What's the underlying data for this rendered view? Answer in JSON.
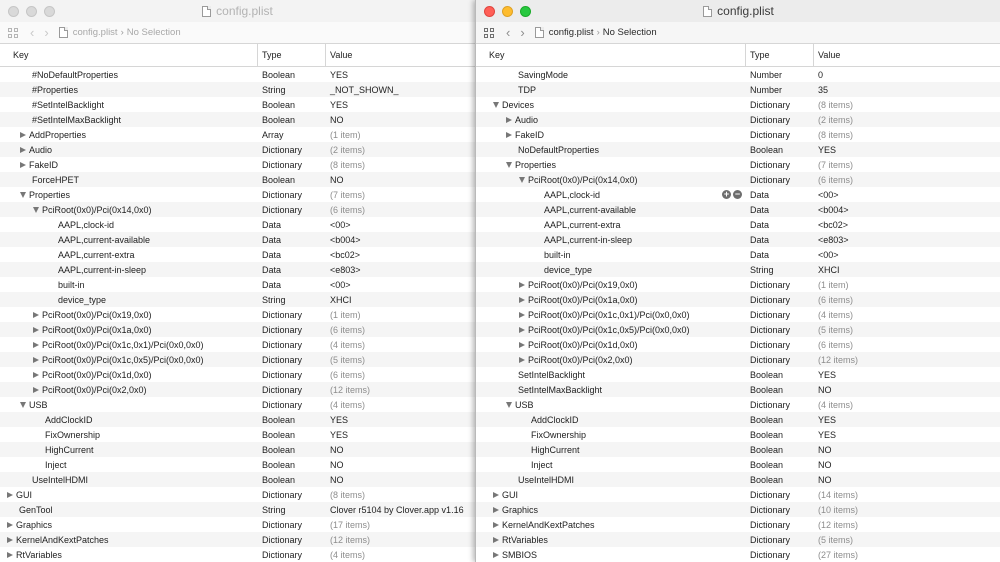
{
  "left": {
    "title": "config.plist",
    "crumb_file": "config.plist",
    "crumb_selection": "No Selection",
    "columns": {
      "key": "Key",
      "type": "Type",
      "value": "Value"
    },
    "rows": [
      {
        "key": "#NoDefaultProperties",
        "type": "Boolean",
        "value": "YES",
        "depth": 2,
        "disclosure": "none",
        "muted": false
      },
      {
        "key": "#Properties",
        "type": "String",
        "value": "_NOT_SHOWN_",
        "depth": 2,
        "disclosure": "none",
        "muted": false
      },
      {
        "key": "#SetIntelBacklight",
        "type": "Boolean",
        "value": "YES",
        "depth": 2,
        "disclosure": "none",
        "muted": false
      },
      {
        "key": "#SetIntelMaxBacklight",
        "type": "Boolean",
        "value": "NO",
        "depth": 2,
        "disclosure": "none",
        "muted": false
      },
      {
        "key": "AddProperties",
        "type": "Array",
        "value": "(1 item)",
        "depth": 2,
        "disclosure": "collapsed",
        "muted": true
      },
      {
        "key": "Audio",
        "type": "Dictionary",
        "value": "(2 items)",
        "depth": 2,
        "disclosure": "collapsed",
        "muted": true
      },
      {
        "key": "FakeID",
        "type": "Dictionary",
        "value": "(8 items)",
        "depth": 2,
        "disclosure": "collapsed",
        "muted": true
      },
      {
        "key": "ForceHPET",
        "type": "Boolean",
        "value": "NO",
        "depth": 2,
        "disclosure": "none",
        "muted": false
      },
      {
        "key": "Properties",
        "type": "Dictionary",
        "value": "(7 items)",
        "depth": 2,
        "disclosure": "expanded",
        "muted": true
      },
      {
        "key": "PciRoot(0x0)/Pci(0x14,0x0)",
        "type": "Dictionary",
        "value": "(6 items)",
        "depth": 3,
        "disclosure": "expanded",
        "muted": true
      },
      {
        "key": "AAPL,clock-id",
        "type": "Data",
        "value": "<00>",
        "depth": 4,
        "disclosure": "none",
        "muted": false
      },
      {
        "key": "AAPL,current-available",
        "type": "Data",
        "value": "<b004>",
        "depth": 4,
        "disclosure": "none",
        "muted": false
      },
      {
        "key": "AAPL,current-extra",
        "type": "Data",
        "value": "<bc02>",
        "depth": 4,
        "disclosure": "none",
        "muted": false
      },
      {
        "key": "AAPL,current-in-sleep",
        "type": "Data",
        "value": "<e803>",
        "depth": 4,
        "disclosure": "none",
        "muted": false
      },
      {
        "key": "built-in",
        "type": "Data",
        "value": "<00>",
        "depth": 4,
        "disclosure": "none",
        "muted": false
      },
      {
        "key": "device_type",
        "type": "String",
        "value": "XHCI",
        "depth": 4,
        "disclosure": "none",
        "muted": false
      },
      {
        "key": "PciRoot(0x0)/Pci(0x19,0x0)",
        "type": "Dictionary",
        "value": "(1 item)",
        "depth": 3,
        "disclosure": "collapsed",
        "muted": true
      },
      {
        "key": "PciRoot(0x0)/Pci(0x1a,0x0)",
        "type": "Dictionary",
        "value": "(6 items)",
        "depth": 3,
        "disclosure": "collapsed",
        "muted": true
      },
      {
        "key": "PciRoot(0x0)/Pci(0x1c,0x1)/Pci(0x0,0x0)",
        "type": "Dictionary",
        "value": "(4 items)",
        "depth": 3,
        "disclosure": "collapsed",
        "muted": true
      },
      {
        "key": "PciRoot(0x0)/Pci(0x1c,0x5)/Pci(0x0,0x0)",
        "type": "Dictionary",
        "value": "(5 items)",
        "depth": 3,
        "disclosure": "collapsed",
        "muted": true
      },
      {
        "key": "PciRoot(0x0)/Pci(0x1d,0x0)",
        "type": "Dictionary",
        "value": "(6 items)",
        "depth": 3,
        "disclosure": "collapsed",
        "muted": true
      },
      {
        "key": "PciRoot(0x0)/Pci(0x2,0x0)",
        "type": "Dictionary",
        "value": "(12 items)",
        "depth": 3,
        "disclosure": "collapsed",
        "muted": true
      },
      {
        "key": "USB",
        "type": "Dictionary",
        "value": "(4 items)",
        "depth": 2,
        "disclosure": "expanded",
        "muted": true
      },
      {
        "key": "AddClockID",
        "type": "Boolean",
        "value": "YES",
        "depth": 3,
        "disclosure": "none",
        "muted": false
      },
      {
        "key": "FixOwnership",
        "type": "Boolean",
        "value": "YES",
        "depth": 3,
        "disclosure": "none",
        "muted": false
      },
      {
        "key": "HighCurrent",
        "type": "Boolean",
        "value": "NO",
        "depth": 3,
        "disclosure": "none",
        "muted": false
      },
      {
        "key": "Inject",
        "type": "Boolean",
        "value": "NO",
        "depth": 3,
        "disclosure": "none",
        "muted": false
      },
      {
        "key": "UseIntelHDMI",
        "type": "Boolean",
        "value": "NO",
        "depth": 2,
        "disclosure": "none",
        "muted": false
      },
      {
        "key": "GUI",
        "type": "Dictionary",
        "value": "(8 items)",
        "depth": 1,
        "disclosure": "collapsed",
        "muted": true
      },
      {
        "key": "GenTool",
        "type": "String",
        "value": "Clover r5104 by Clover.app v1.16",
        "depth": 1,
        "disclosure": "none",
        "muted": false
      },
      {
        "key": "Graphics",
        "type": "Dictionary",
        "value": "(17 items)",
        "depth": 1,
        "disclosure": "collapsed",
        "muted": true
      },
      {
        "key": "KernelAndKextPatches",
        "type": "Dictionary",
        "value": "(12 items)",
        "depth": 1,
        "disclosure": "collapsed",
        "muted": true
      },
      {
        "key": "RtVariables",
        "type": "Dictionary",
        "value": "(4 items)",
        "depth": 1,
        "disclosure": "collapsed",
        "muted": true
      }
    ]
  },
  "right": {
    "title": "config.plist",
    "crumb_file": "config.plist",
    "crumb_selection": "No Selection",
    "columns": {
      "key": "Key",
      "type": "Type",
      "value": "Value"
    },
    "rows": [
      {
        "key": "SavingMode",
        "type": "Number",
        "value": "0",
        "depth": 2,
        "disclosure": "none",
        "muted": false
      },
      {
        "key": "TDP",
        "type": "Number",
        "value": "35",
        "depth": 2,
        "disclosure": "none",
        "muted": false
      },
      {
        "key": "Devices",
        "type": "Dictionary",
        "value": "(8 items)",
        "depth": 1,
        "disclosure": "expanded",
        "muted": true
      },
      {
        "key": "Audio",
        "type": "Dictionary",
        "value": "(2 items)",
        "depth": 2,
        "disclosure": "collapsed",
        "muted": true
      },
      {
        "key": "FakeID",
        "type": "Dictionary",
        "value": "(8 items)",
        "depth": 2,
        "disclosure": "collapsed",
        "muted": true
      },
      {
        "key": "NoDefaultProperties",
        "type": "Boolean",
        "value": "YES",
        "depth": 2,
        "disclosure": "none",
        "muted": false
      },
      {
        "key": "Properties",
        "type": "Dictionary",
        "value": "(7 items)",
        "depth": 2,
        "disclosure": "expanded",
        "muted": true
      },
      {
        "key": "PciRoot(0x0)/Pci(0x14,0x0)",
        "type": "Dictionary",
        "value": "(6 items)",
        "depth": 3,
        "disclosure": "expanded",
        "muted": true
      },
      {
        "key": "AAPL,clock-id",
        "type": "Data",
        "value": "<00>",
        "depth": 4,
        "disclosure": "none",
        "muted": false,
        "buttons": true
      },
      {
        "key": "AAPL,current-available",
        "type": "Data",
        "value": "<b004>",
        "depth": 4,
        "disclosure": "none",
        "muted": false
      },
      {
        "key": "AAPL,current-extra",
        "type": "Data",
        "value": "<bc02>",
        "depth": 4,
        "disclosure": "none",
        "muted": false
      },
      {
        "key": "AAPL,current-in-sleep",
        "type": "Data",
        "value": "<e803>",
        "depth": 4,
        "disclosure": "none",
        "muted": false
      },
      {
        "key": "built-in",
        "type": "Data",
        "value": "<00>",
        "depth": 4,
        "disclosure": "none",
        "muted": false
      },
      {
        "key": "device_type",
        "type": "String",
        "value": "XHCI",
        "depth": 4,
        "disclosure": "none",
        "muted": false
      },
      {
        "key": "PciRoot(0x0)/Pci(0x19,0x0)",
        "type": "Dictionary",
        "value": "(1 item)",
        "depth": 3,
        "disclosure": "collapsed",
        "muted": true
      },
      {
        "key": "PciRoot(0x0)/Pci(0x1a,0x0)",
        "type": "Dictionary",
        "value": "(6 items)",
        "depth": 3,
        "disclosure": "collapsed",
        "muted": true
      },
      {
        "key": "PciRoot(0x0)/Pci(0x1c,0x1)/Pci(0x0,0x0)",
        "type": "Dictionary",
        "value": "(4 items)",
        "depth": 3,
        "disclosure": "collapsed",
        "muted": true
      },
      {
        "key": "PciRoot(0x0)/Pci(0x1c,0x5)/Pci(0x0,0x0)",
        "type": "Dictionary",
        "value": "(5 items)",
        "depth": 3,
        "disclosure": "collapsed",
        "muted": true
      },
      {
        "key": "PciRoot(0x0)/Pci(0x1d,0x0)",
        "type": "Dictionary",
        "value": "(6 items)",
        "depth": 3,
        "disclosure": "collapsed",
        "muted": true
      },
      {
        "key": "PciRoot(0x0)/Pci(0x2,0x0)",
        "type": "Dictionary",
        "value": "(12 items)",
        "depth": 3,
        "disclosure": "collapsed",
        "muted": true
      },
      {
        "key": "SetIntelBacklight",
        "type": "Boolean",
        "value": "YES",
        "depth": 2,
        "disclosure": "none",
        "muted": false
      },
      {
        "key": "SetIntelMaxBacklight",
        "type": "Boolean",
        "value": "NO",
        "depth": 2,
        "disclosure": "none",
        "muted": false
      },
      {
        "key": "USB",
        "type": "Dictionary",
        "value": "(4 items)",
        "depth": 2,
        "disclosure": "expanded",
        "muted": true
      },
      {
        "key": "AddClockID",
        "type": "Boolean",
        "value": "YES",
        "depth": 3,
        "disclosure": "none",
        "muted": false
      },
      {
        "key": "FixOwnership",
        "type": "Boolean",
        "value": "YES",
        "depth": 3,
        "disclosure": "none",
        "muted": false
      },
      {
        "key": "HighCurrent",
        "type": "Boolean",
        "value": "NO",
        "depth": 3,
        "disclosure": "none",
        "muted": false
      },
      {
        "key": "Inject",
        "type": "Boolean",
        "value": "NO",
        "depth": 3,
        "disclosure": "none",
        "muted": false
      },
      {
        "key": "UseIntelHDMI",
        "type": "Boolean",
        "value": "NO",
        "depth": 2,
        "disclosure": "none",
        "muted": false
      },
      {
        "key": "GUI",
        "type": "Dictionary",
        "value": "(14 items)",
        "depth": 1,
        "disclosure": "collapsed",
        "muted": true
      },
      {
        "key": "Graphics",
        "type": "Dictionary",
        "value": "(10 items)",
        "depth": 1,
        "disclosure": "collapsed",
        "muted": true
      },
      {
        "key": "KernelAndKextPatches",
        "type": "Dictionary",
        "value": "(12 items)",
        "depth": 1,
        "disclosure": "collapsed",
        "muted": true
      },
      {
        "key": "RtVariables",
        "type": "Dictionary",
        "value": "(5 items)",
        "depth": 1,
        "disclosure": "collapsed",
        "muted": true
      },
      {
        "key": "SMBIOS",
        "type": "Dictionary",
        "value": "(27 items)",
        "depth": 1,
        "disclosure": "collapsed",
        "muted": true
      }
    ]
  }
}
